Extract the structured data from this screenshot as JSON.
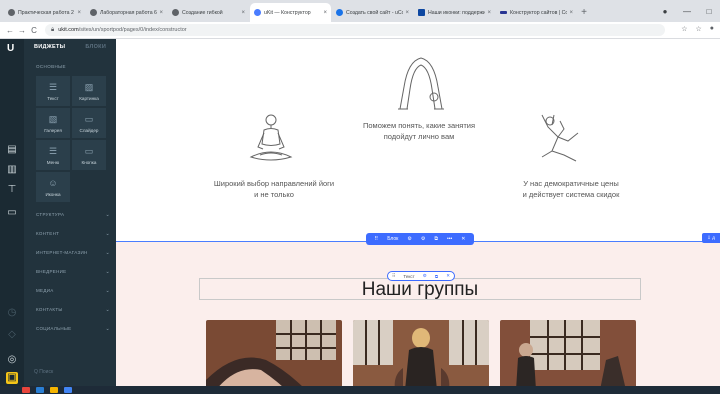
{
  "browser": {
    "tabs": [
      {
        "title": "Практическая работа 2",
        "favicon_color": "#5f6368",
        "active": false
      },
      {
        "title": "Лабораторная работа 6 (Осуі…",
        "favicon_color": "#5f6368",
        "active": false
      },
      {
        "title": "Создание гибкой",
        "favicon_color": "#5f6368",
        "active": false
      },
      {
        "title": "uKit — Конструктор",
        "favicon_color": "#4a7dff",
        "active": true
      },
      {
        "title": "Создать свой сайт - uCoz",
        "favicon_color": "#1a73e8",
        "active": false
      },
      {
        "title": "Наши иконки: поддерживать…",
        "favicon_color": "#0d47a1",
        "active": false
      },
      {
        "title": "Конструктор сайтов | Создать…",
        "favicon_color": "#283593",
        "active": false
      }
    ],
    "tab_close": "×",
    "new_tab": "+",
    "window_controls": [
      "●",
      "—",
      "□"
    ],
    "nav": {
      "back": "←",
      "forward": "→",
      "reload": "C"
    },
    "url_domain": "ukit.com",
    "url_path": "/sites/un/sportpod/pages/0/index/constructor",
    "toolbar_icons": [
      "☆",
      "☆",
      "●"
    ]
  },
  "rail": {
    "logo": "U",
    "icons": [
      "▤",
      "▥",
      "⊤",
      "▭",
      "◷",
      "◇",
      "◎",
      "▣"
    ]
  },
  "panel": {
    "tab_widgets": "ВИДЖЕТЫ",
    "tab_blocks": "БЛОКИ",
    "section_basic": "ОСНОВНЫЕ",
    "widgets": [
      {
        "label": "Текст",
        "icon": "☰"
      },
      {
        "label": "Картинка",
        "icon": "▨"
      },
      {
        "label": "Галерея",
        "icon": "▧"
      },
      {
        "label": "Слайдер",
        "icon": "▭"
      },
      {
        "label": "Меню",
        "icon": "☰"
      },
      {
        "label": "Кнопка",
        "icon": "▭"
      },
      {
        "label": "Иконка",
        "icon": "☺"
      }
    ],
    "categories": [
      "СТРУКТУРА",
      "КОНТЕНТ",
      "ИНТЕРНЕТ-МАГАЗИН",
      "ВНЕДРЕНИЕ",
      "МЕДИА",
      "КОНТАКТЫ",
      "СОЦИАЛЬНЫЕ"
    ],
    "chevron": "⌄",
    "search_placeholder": "Q Поиск"
  },
  "canvas": {
    "features": [
      {
        "text": "Широкий выбор направлений йоги\nи не только"
      },
      {
        "text": "Поможем понять, какие занятия\nподойдут лично вам"
      },
      {
        "text": "У нас демократичные цены\nи действует система скидок"
      }
    ],
    "block_toolbar": {
      "drag": "⠿",
      "label": "Блок",
      "icons": [
        "⚙",
        "⚙",
        "⧉",
        "•••",
        "✕"
      ]
    },
    "right_badge": "⇩ д",
    "text_toolbar": {
      "drag": "⠿",
      "label": "Текст",
      "icons": [
        "⚙",
        "⧉",
        "✕"
      ]
    },
    "section_title": "Наши группы"
  },
  "colors": {
    "accent": "#3d6cff",
    "panel_bg": "#22333d",
    "rail_bg": "#1b2a33",
    "section_bg": "#fbeeec"
  },
  "taskbar": {
    "tray": "",
    "icon_colors": [
      "#e8453c",
      "#2a7fd4",
      "#f4b400",
      "#4285f4"
    ]
  }
}
